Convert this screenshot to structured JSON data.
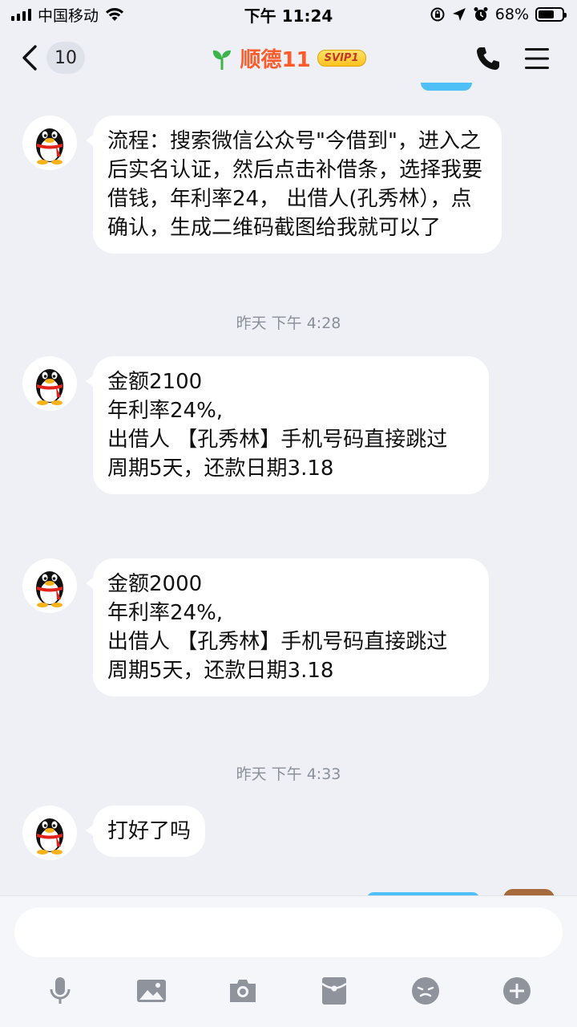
{
  "status_bar": {
    "carrier": "中国移动",
    "time": "下午 11:24",
    "battery_percent": "68%",
    "battery_level": 0.68
  },
  "header": {
    "unread_count": "10",
    "title": "顺德11",
    "badge": "SVIP1",
    "icons": [
      "back-chevron-icon",
      "sprout-icon",
      "phone-icon",
      "menu-icon"
    ]
  },
  "messages": [
    {
      "type": "incoming",
      "text": "流程：搜索微信公众号\"今借到\"，进入之后实名认证，然后点击补借条，选择我要借钱，年利率24， 出借人(孔秀林），点确认，生成二维码截图给我就可以了"
    },
    {
      "type": "timestamp",
      "text": "昨天 下午 4:28"
    },
    {
      "type": "incoming",
      "text": "金额2100\n年利率24%,\n出借人 【孔秀林】手机号码直接跳过\n周期5天，还款日期3.18"
    },
    {
      "type": "incoming",
      "text": "金额2000\n年利率24%,\n出借人 【孔秀林】手机号码直接跳过\n周期5天，还款日期3.18"
    },
    {
      "type": "timestamp",
      "text": "昨天 下午 4:33"
    },
    {
      "type": "incoming",
      "text": "打好了吗"
    }
  ],
  "composer": {
    "input_value": "",
    "toolbar_icons": [
      "microphone-icon",
      "image-icon",
      "camera-icon",
      "red-packet-icon",
      "emoji-icon",
      "plus-icon"
    ]
  },
  "colors": {
    "background": "#eef0f6",
    "title": "#ff5a2a",
    "bubble": "#ffffff",
    "timestamp": "#8a8f9a",
    "toolbar_icon": "#8e939c"
  }
}
